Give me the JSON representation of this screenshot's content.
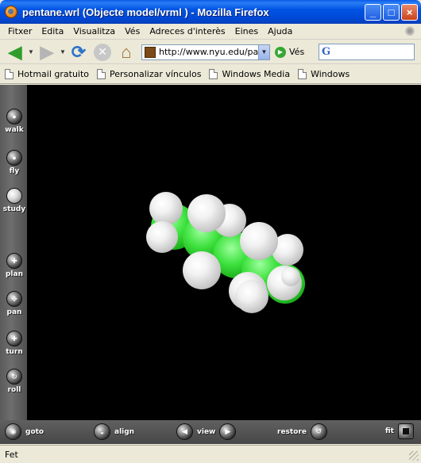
{
  "window": {
    "title": "pentane.wrl (Objecte model/vrml ) - Mozilla Firefox",
    "buttons": {
      "minimize": "_",
      "maximize": "□",
      "close": "×"
    }
  },
  "menu": [
    "Fitxer",
    "Edita",
    "Visualitza",
    "Vés",
    "Adreces d'interès",
    "Eines",
    "Ajuda"
  ],
  "toolbar": {
    "url": "http://www.nyu.edu/pages",
    "go_label": "Vés",
    "search_value": ""
  },
  "bookmarks": [
    "Hotmail gratuito",
    "Personalizar vínculos",
    "Windows Media",
    "Windows"
  ],
  "viewer": {
    "left_tools": [
      {
        "label": "walk",
        "icon": "walk-icon",
        "active": false
      },
      {
        "label": "fly",
        "icon": "fly-icon",
        "active": false
      },
      {
        "label": "study",
        "icon": "study-icon",
        "active": true
      },
      {
        "label": "plan",
        "icon": "plan-icon",
        "active": false
      },
      {
        "label": "pan",
        "icon": "pan-icon",
        "active": false
      },
      {
        "label": "turn",
        "icon": "turn-icon",
        "active": false
      },
      {
        "label": "roll",
        "icon": "roll-icon",
        "active": false
      }
    ],
    "bottom_controls": {
      "goto": "goto",
      "align": "align",
      "view": "view",
      "restore": "restore",
      "fit": "fit"
    },
    "model": {
      "name": "pentane",
      "carbon_color": "#33d633",
      "hydrogen_color": "#f0f0f0",
      "background": "#000000"
    }
  },
  "status": {
    "text": "Fet"
  }
}
